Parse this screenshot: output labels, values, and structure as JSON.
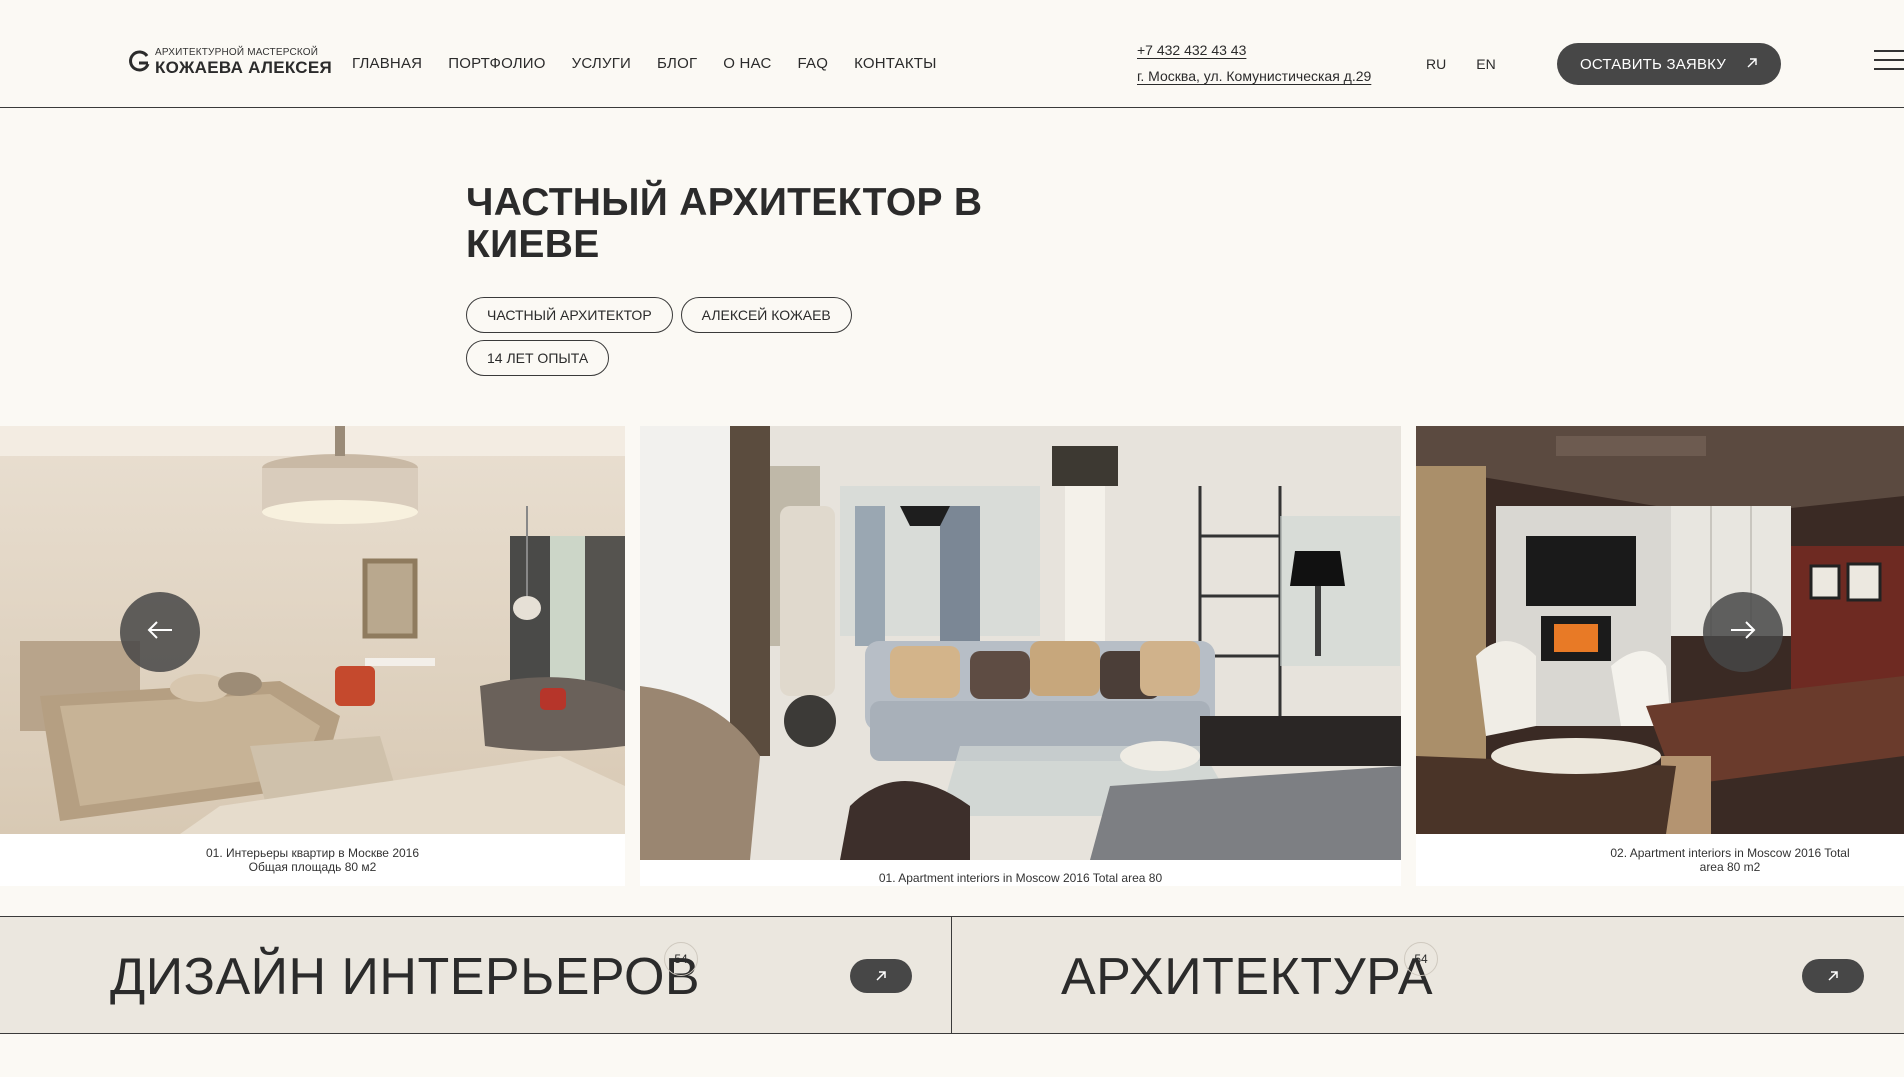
{
  "header": {
    "logo": {
      "line1": "АРХИТЕКТУРНОЙ МАСТЕРСКОЙ",
      "line2": "КОЖАЕВА АЛЕКСЕЯ"
    },
    "nav": [
      {
        "label": "ГЛАВНАЯ"
      },
      {
        "label": "ПОРТФОЛИО"
      },
      {
        "label": "УСЛУГИ"
      },
      {
        "label": "БЛОГ"
      },
      {
        "label": "О НАС"
      },
      {
        "label": "FAQ"
      },
      {
        "label": "КОНТАКТЫ"
      }
    ],
    "phone": "+7 432 432 43 43",
    "address": "г. Москва, ул. Комунистическая д.29",
    "languages": [
      "RU",
      "EN"
    ],
    "cta_label": "ОСТАВИТЬ ЗАЯВКУ"
  },
  "hero": {
    "title": "ЧАСТНЫЙ АРХИТЕКТОР В КИЕВЕ",
    "tags": [
      "ЧАСТНЫЙ АРХИТЕКТОР",
      "АЛЕКСЕЙ КОЖАЕВ",
      "14 ЛЕТ ОПЫТА"
    ]
  },
  "slider": {
    "slides": [
      {
        "caption_line1": "01. Интерьеры квартир в Москве 2016",
        "caption_line2": "Общая площадь 80 м2"
      },
      {
        "caption_line1": "01. Apartment interiors in Moscow 2016 Total area 80",
        "caption_line2": ""
      },
      {
        "caption_line1": "02. Apartment interiors in Moscow 2016 Total",
        "caption_line2": "area 80 m2"
      }
    ]
  },
  "categories": [
    {
      "title": "ДИЗАЙН ИНТЕРЬЕРОВ",
      "count": "54"
    },
    {
      "title": "АРХИТЕКТУРА",
      "count": "54"
    }
  ],
  "colors": {
    "background": "#fbf9f4",
    "accent_dark": "#474747",
    "category_bg": "#ebe7df",
    "text": "#2b2b2b"
  },
  "icons": [
    "logo-mark-icon",
    "arrow-up-right-icon",
    "burger-menu-icon",
    "arrow-left-icon",
    "arrow-right-icon"
  ]
}
